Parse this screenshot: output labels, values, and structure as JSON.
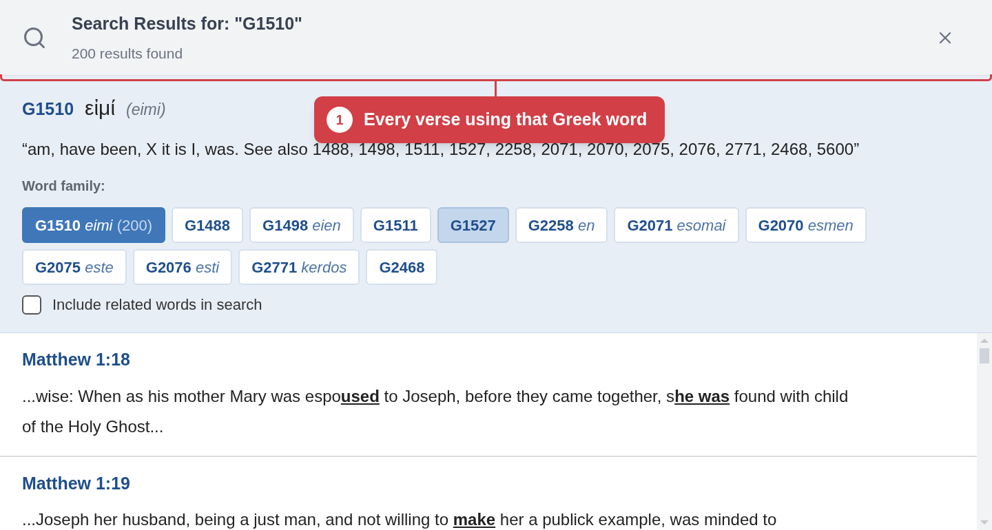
{
  "header": {
    "title": "Search Results for: \"G1510\"",
    "subtitle": "200 results found"
  },
  "callout": {
    "number": "1",
    "text": "Every verse using that Greek word"
  },
  "word": {
    "code": "G1510",
    "greek": "εἰμί",
    "translit": "(eimi)",
    "definition": "“am, have been, X it is I, was. See also 1488, 1498, 1511, 1527, 2258, 2071, 2070, 2075, 2076, 2771, 2468, 5600”",
    "family_label": "Word family:",
    "family": [
      {
        "code": "G1510",
        "translit": "eimi",
        "count": "(200)",
        "selected": true,
        "hovered": false
      },
      {
        "code": "G1488",
        "selected": false,
        "hovered": false
      },
      {
        "code": "G1498",
        "translit": "eien",
        "selected": false,
        "hovered": false
      },
      {
        "code": "G1511",
        "selected": false,
        "hovered": false
      },
      {
        "code": "G1527",
        "selected": false,
        "hovered": true
      },
      {
        "code": "G2258",
        "translit": "en",
        "selected": false,
        "hovered": false
      },
      {
        "code": "G2071",
        "translit": "esomai",
        "selected": false,
        "hovered": false
      },
      {
        "code": "G2070",
        "translit": "esmen",
        "selected": false,
        "hovered": false
      },
      {
        "code": "G2075",
        "translit": "este",
        "selected": false,
        "hovered": false
      },
      {
        "code": "G2076",
        "translit": "esti",
        "selected": false,
        "hovered": false
      },
      {
        "code": "G2771",
        "translit": "kerdos",
        "selected": false,
        "hovered": false
      },
      {
        "code": "G2468",
        "selected": false,
        "hovered": false
      }
    ],
    "include_related": {
      "label": "Include related words in search",
      "checked": false
    }
  },
  "results": [
    {
      "reference": "Matthew 1:18",
      "text": "...wise: When as his mother Mary was espo**used** to Joseph, before they came together, s**he was** found with child of the Holy Ghost..."
    },
    {
      "reference": "Matthew 1:19",
      "text": "...Joseph her husband, being a just man, and not willing to **make** her a publick example, was minded to"
    }
  ]
}
